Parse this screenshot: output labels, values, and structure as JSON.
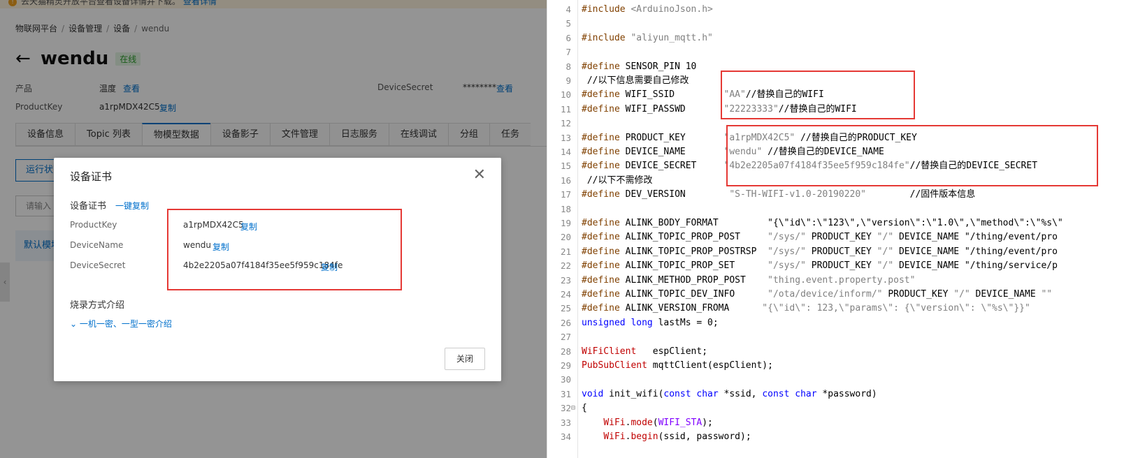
{
  "console": {
    "notice_text": "去天猫精灵开放平台查看设备详情并下载。",
    "notice_link": "查看详情",
    "breadcrumb": [
      "物联网平台",
      "设备管理",
      "设备",
      "wendu"
    ],
    "device_title": "wendu",
    "status": "在线",
    "product_label": "产品",
    "product_value": "温度",
    "view_label": "查看",
    "productkey_label": "ProductKey",
    "productkey_value": "a1rpMDX42C5",
    "copy_label": "复制",
    "devicesecret_label": "DeviceSecret",
    "devicesecret_value": "********",
    "tabs": [
      "设备信息",
      "Topic 列表",
      "物模型数据",
      "设备影子",
      "文件管理",
      "日志服务",
      "在线调试",
      "分组",
      "任务"
    ],
    "active_tab": "物模型数据",
    "runstate_button": "运行状态",
    "input_placeholder": "请输入",
    "default_module": "默认模块"
  },
  "modal": {
    "title": "设备证书",
    "section_label": "设备证书",
    "copy_all": "一键复制",
    "fields": [
      {
        "key": "ProductKey",
        "value": "a1rpMDX42C5",
        "copy": "复制"
      },
      {
        "key": "DeviceName",
        "value": "wendu",
        "copy": "复制"
      },
      {
        "key": "DeviceSecret",
        "value": "4b2e2205a07f4184f35ee5f959c184fe",
        "copy": "复制"
      }
    ],
    "burn_title": "烧录方式介绍",
    "burn_link": "一机一密、一型一密介绍",
    "close_button": "关闭"
  },
  "editor": {
    "lines": [
      {
        "n": "4",
        "t": "#include <ArduinoJson.h>"
      },
      {
        "n": "5",
        "t": ""
      },
      {
        "n": "6",
        "t": "#include \"aliyun_mqtt.h\""
      },
      {
        "n": "7",
        "t": ""
      },
      {
        "n": "8",
        "t": "#define SENSOR_PIN 10"
      },
      {
        "n": "9",
        "t": " //以下信息需要自己修改"
      },
      {
        "n": "10",
        "t": "#define WIFI_SSID         \"AA\"//替换自己的WIFI"
      },
      {
        "n": "11",
        "t": "#define WIFI_PASSWD       \"22223333\"//替换自己的WIFI"
      },
      {
        "n": "12",
        "t": ""
      },
      {
        "n": "13",
        "t": "#define PRODUCT_KEY       \"a1rpMDX42C5\" //替换自己的PRODUCT_KEY"
      },
      {
        "n": "14",
        "t": "#define DEVICE_NAME       \"wendu\" //替换自己的DEVICE_NAME"
      },
      {
        "n": "15",
        "t": "#define DEVICE_SECRET     \"4b2e2205a07f4184f35ee5f959c184fe\"//替换自己的DEVICE_SECRET"
      },
      {
        "n": "16",
        "t": " //以下不需修改"
      },
      {
        "n": "17",
        "t": "#define DEV_VERSION        \"S-TH-WIFI-v1.0-20190220\"        //固件版本信息"
      },
      {
        "n": "18",
        "t": ""
      },
      {
        "n": "19",
        "t": "#define ALINK_BODY_FORMAT         \"{\\\"id\\\":\\\"123\\\",\\\"version\\\":\\\"1.0\\\",\\\"method\\\":\\\"%s\\\""
      },
      {
        "n": "20",
        "t": "#define ALINK_TOPIC_PROP_POST     \"/sys/\" PRODUCT_KEY \"/\" DEVICE_NAME \"/thing/event/pro"
      },
      {
        "n": "21",
        "t": "#define ALINK_TOPIC_PROP_POSTRSP  \"/sys/\" PRODUCT_KEY \"/\" DEVICE_NAME \"/thing/event/pro"
      },
      {
        "n": "22",
        "t": "#define ALINK_TOPIC_PROP_SET      \"/sys/\" PRODUCT_KEY \"/\" DEVICE_NAME \"/thing/service/p"
      },
      {
        "n": "23",
        "t": "#define ALINK_METHOD_PROP_POST    \"thing.event.property.post\""
      },
      {
        "n": "24",
        "t": "#define ALINK_TOPIC_DEV_INFO      \"/ota/device/inform/\" PRODUCT_KEY \"/\" DEVICE_NAME \"\""
      },
      {
        "n": "25",
        "t": "#define ALINK_VERSION_FROMA      \"{\\\"id\\\": 123,\\\"params\\\": {\\\"version\\\": \\\"%s\\\"}}\""
      },
      {
        "n": "26",
        "t": "unsigned long lastMs = 0;"
      },
      {
        "n": "27",
        "t": ""
      },
      {
        "n": "28",
        "t": "WiFiClient   espClient;"
      },
      {
        "n": "29",
        "t": "PubSubClient mqttClient(espClient);"
      },
      {
        "n": "30",
        "t": ""
      },
      {
        "n": "31",
        "t": "void init_wifi(const char *ssid, const char *password)"
      },
      {
        "n": "32",
        "t": "{"
      },
      {
        "n": "33",
        "t": "    WiFi.mode(WIFI_STA);"
      },
      {
        "n": "34",
        "t": "    WiFi.begin(ssid, password);"
      }
    ]
  }
}
